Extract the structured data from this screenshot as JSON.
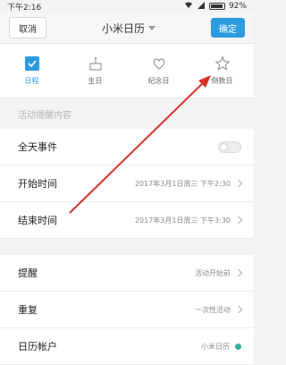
{
  "status_bar": {
    "time": "下午2:16",
    "battery": "92%"
  },
  "header": {
    "cancel_label": "取消",
    "title": "小米日历",
    "confirm_label": "确定"
  },
  "tabs": [
    {
      "label": "日程",
      "icon": "checkbox-icon",
      "active": true
    },
    {
      "label": "生日",
      "icon": "cake-icon",
      "active": false
    },
    {
      "label": "纪念日",
      "icon": "heart-icon",
      "active": false
    },
    {
      "label": "倒数日",
      "icon": "star-icon",
      "active": false
    }
  ],
  "form": {
    "content_placeholder": "活动提醒内容",
    "all_day_label": "全天事件",
    "start_label": "开始时间",
    "start_value": "2017年3月1日周三 下午2:30",
    "end_label": "结束时间",
    "end_value": "2017年3月1日周三 下午3:30",
    "reminder_label": "提醒",
    "reminder_value": "活动开始前",
    "repeat_label": "重复",
    "repeat_value": "一次性活动",
    "account_label": "日历帐户",
    "account_value": "小米日历"
  },
  "colors": {
    "accent": "#2d9be0",
    "annotation_arrow": "#d8322b",
    "account_dot": "#2fb1a3"
  }
}
